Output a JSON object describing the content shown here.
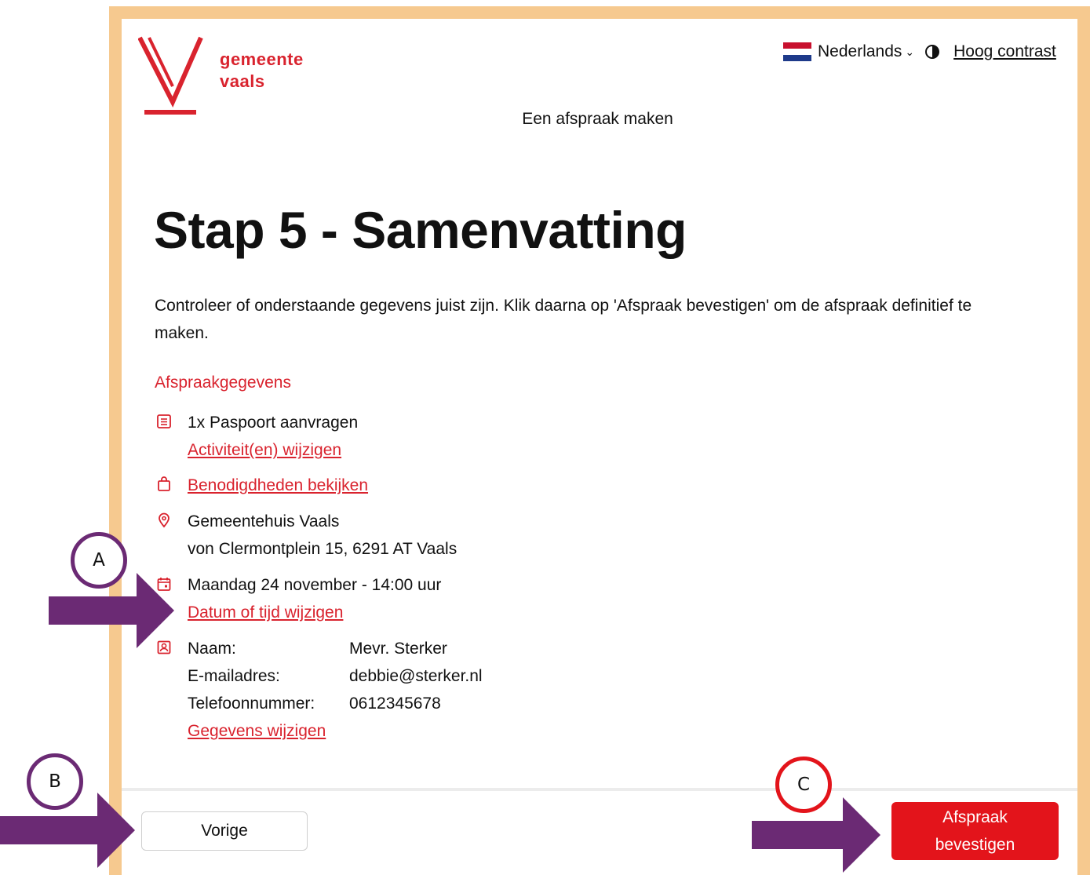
{
  "header": {
    "logo_line1": "gemeente",
    "logo_line2": "vaals",
    "language": "Nederlands",
    "contrast_label": "Hoog contrast",
    "subtitle": "Een afspraak maken"
  },
  "page": {
    "title": "Stap 5 - Samenvatting",
    "intro": "Controleer of onderstaande gegevens juist zijn. Klik daarna op 'Afspraak bevestigen' om de afspraak definitief te maken."
  },
  "summary": {
    "section_title": "Afspraakgegevens",
    "activity": "1x Paspoort aanvragen",
    "activity_link": "Activiteit(en) wijzigen",
    "requirements_link": "Benodigdheden bekijken",
    "location_name": "Gemeentehuis Vaals",
    "location_address": "von Clermontplein 15, 6291 AT Vaals",
    "datetime": "Maandag 24 november - 14:00 uur",
    "datetime_link": "Datum of tijd wijzigen",
    "contact": {
      "name_label": "Naam:",
      "name_value": "Mevr. Sterker",
      "email_label": "E-mailadres:",
      "email_value": "debbie@sterker.nl",
      "phone_label": "Telefoonnummer:",
      "phone_value": "0612345678"
    },
    "contact_link": "Gegevens wijzigen"
  },
  "footer": {
    "prev_label": "Vorige",
    "confirm_line1": "Afspraak",
    "confirm_line2": "bevestigen"
  },
  "annotations": {
    "marker_a": "A",
    "marker_b": "B",
    "marker_c": "C"
  },
  "colors": {
    "brand_red": "#d9232e",
    "button_red": "#e3141b",
    "frame": "#f6c98f",
    "annotation_purple": "#6b2a74"
  }
}
